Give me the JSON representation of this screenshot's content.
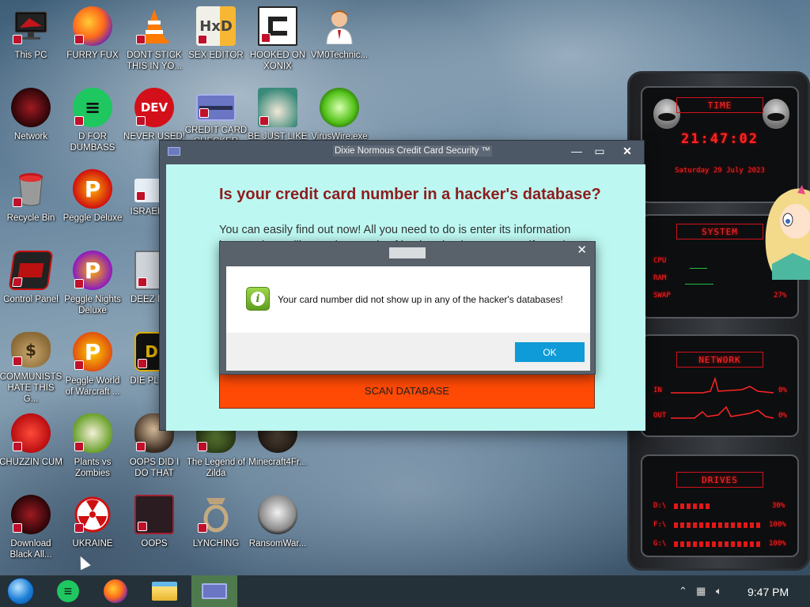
{
  "desktop": {
    "icons": [
      {
        "label": "This PC",
        "icon": "monitor-icon"
      },
      {
        "label": "FURRY FUX",
        "icon": "firefox-icon"
      },
      {
        "label": "DONT STICK THIS IN YO...",
        "icon": "traffic-cone-icon"
      },
      {
        "label": "SEX EDITOR",
        "icon": "hex-editor-icon"
      },
      {
        "label": "HOOKED ON XONIX",
        "icon": "xonix-game-icon"
      },
      {
        "label": "VM0Technic...",
        "icon": "technician-icon"
      },
      {
        "label": "Network",
        "icon": "network-orb-icon"
      },
      {
        "label": "D FOR DUMBASS",
        "icon": "chat-app-icon"
      },
      {
        "label": "NEVER USED!",
        "icon": "dev-cpp-icon"
      },
      {
        "label": "CREDIT CARD CHECKER",
        "icon": "credit-card-icon"
      },
      {
        "label": "BE JUST LIKE THE DUDE!",
        "icon": "santa-icon"
      },
      {
        "label": "VirusWire.exe",
        "icon": "limewire-icon"
      },
      {
        "label": "Recycle Bin",
        "icon": "recycle-bin-icon"
      },
      {
        "label": "Peggle Deluxe",
        "icon": "peggle-icon"
      },
      {
        "label": "ISRAEL S...",
        "icon": "flag-icon"
      },
      {
        "label": "Control Panel",
        "icon": "control-panel-icon"
      },
      {
        "label": "Peggle Nights Deluxe",
        "icon": "peggle-nights-icon"
      },
      {
        "label": "DEEZ NU...",
        "icon": "folder-stack-icon"
      },
      {
        "label": "COMMUNISTS HATE THIS G...",
        "icon": "money-bag-icon"
      },
      {
        "label": "Peggle World of Warcraft ...",
        "icon": "peggle-wow-icon"
      },
      {
        "label": "DIE PLEA...",
        "icon": "die-icon"
      },
      {
        "label": "CHUZZIN CUM",
        "icon": "chuzzle-icon"
      },
      {
        "label": "Plants vs Zombies",
        "icon": "plants-vs-zombies-icon"
      },
      {
        "label": "OOPS DID I DO THAT",
        "icon": "portrait-icon"
      },
      {
        "label": "The Legend of Zilda",
        "icon": "zelda-icon"
      },
      {
        "label": "Minecraft4Fr...",
        "icon": "minecraft-icon"
      },
      {
        "label": "Download Black All...",
        "icon": "alien-orb-icon"
      },
      {
        "label": "UKRAINE",
        "icon": "radiation-icon"
      },
      {
        "label": "OOPS",
        "icon": "oops-app-icon"
      },
      {
        "label": "LYNCHING",
        "icon": "noose-icon"
      },
      {
        "label": "RansomWar...",
        "icon": "skull-icon"
      }
    ]
  },
  "main_window": {
    "title": "Dixie Normous Credit Card Security ™",
    "controls": {
      "minimize": "—",
      "maximize": "▭",
      "close": "✕"
    },
    "heading": "Is your credit card number in a hacker's database?",
    "paragraph": "You can easily find out now! All you need to do is enter its information here and we will scan thousands of hacker databases to see if any they have match yours.",
    "scan_button": "SCAN DATABASE"
  },
  "message_box": {
    "close": "✕",
    "icon": "info-icon",
    "text": "Your card number did not show up in any of the hacker's databases!",
    "ok_button": "OK"
  },
  "gadget": {
    "time_header": "TIME",
    "time": "21:47:02",
    "date": "Saturday 29 July 2023",
    "system_header": "SYSTEM",
    "cpu_label": "CPU",
    "ram_label": "RAM",
    "swap_label": "SWAP",
    "swap_value": "27%",
    "network_header": "NETWORK",
    "in_label": "IN",
    "in_value": "0%",
    "out_label": "OUT",
    "out_value": "0%",
    "drives_header": "DRIVES",
    "drives": [
      {
        "label": "D:\\",
        "value": "30%"
      },
      {
        "label": "F:\\",
        "value": "100%"
      },
      {
        "label": "G:\\",
        "value": "100%"
      }
    ]
  },
  "taskbar": {
    "items": [
      "start-orb-icon",
      "chat-app-icon",
      "firefox-icon",
      "file-explorer-icon",
      "credit-card-app-icon"
    ],
    "clock": "9:47 PM",
    "tray": [
      "up-arrow-icon",
      "network-tray-icon",
      "volume-icon"
    ]
  },
  "colors": {
    "window_body": "#bdf7f1",
    "heading": "#8d1d1d",
    "scan_button": "#ff4a06",
    "ok_button": "#0f9bd7",
    "gadget_red": "#ff2424",
    "taskbar": "#253138"
  }
}
